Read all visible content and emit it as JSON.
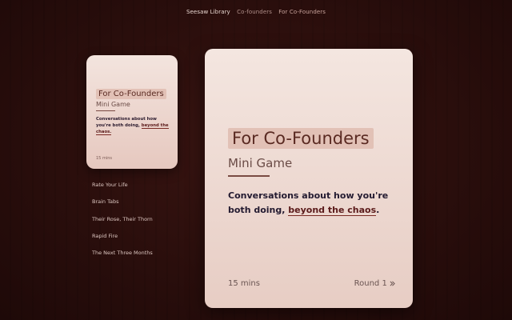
{
  "breadcrumb": {
    "root": "Seesaw Library",
    "section": "Co-founders",
    "current": "For Co-Founders"
  },
  "preview_card": {
    "title": "For Co-Founders",
    "subtitle": "Mini Game",
    "description_plain": "Conversations about how you're both doing, ",
    "description_highlight": "beyond the chaos.",
    "duration": "15 mins"
  },
  "games": [
    {
      "label": "Rate Your Life"
    },
    {
      "label": "Brain Tabs"
    },
    {
      "label": "Their Rose, Their Thorn"
    },
    {
      "label": "Rapid Fire"
    },
    {
      "label": "The Next Three Months"
    }
  ],
  "main_card": {
    "title": "For Co-Founders",
    "subtitle": "Mini Game",
    "description_plain": "Conversations about how you're both doing, ",
    "description_highlight": "beyond the chaos",
    "description_end": ".",
    "duration": "15 mins",
    "round_label": "Round 1",
    "round_icon": "double-chevron-right-icon"
  },
  "colors": {
    "background": "#2a0e0c",
    "card": "#f3e4de",
    "title_highlight": "#e2c1b6",
    "title_text": "#5a2a22",
    "accent_underline": "#7a2a24"
  }
}
